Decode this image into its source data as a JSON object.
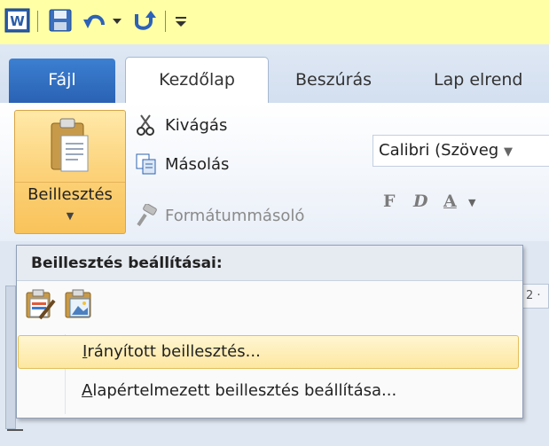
{
  "quick_access": {
    "icons": [
      "word-logo-icon",
      "save-icon",
      "undo-icon",
      "redo-icon",
      "customize-icon"
    ]
  },
  "tabs": {
    "file": "Fájl",
    "home": "Kezdőlap",
    "insert": "Beszúrás",
    "layout": "Lap elrend"
  },
  "clipboard": {
    "paste": "Beillesztés",
    "cut": "Kivágás",
    "copy": "Másolás",
    "format_painter": "Formátummásoló"
  },
  "font": {
    "name": "Calibri (Szöveg",
    "buttons": [
      "F",
      "D",
      "A"
    ]
  },
  "paste_menu": {
    "header": "Beillesztés beállításai:",
    "items": [
      {
        "accel": "I",
        "rest": "rányított beillesztés..."
      },
      {
        "accel": "A",
        "rest": "lapértelmezett beillesztés beállítása..."
      }
    ]
  },
  "ruler_text": "2 ·"
}
